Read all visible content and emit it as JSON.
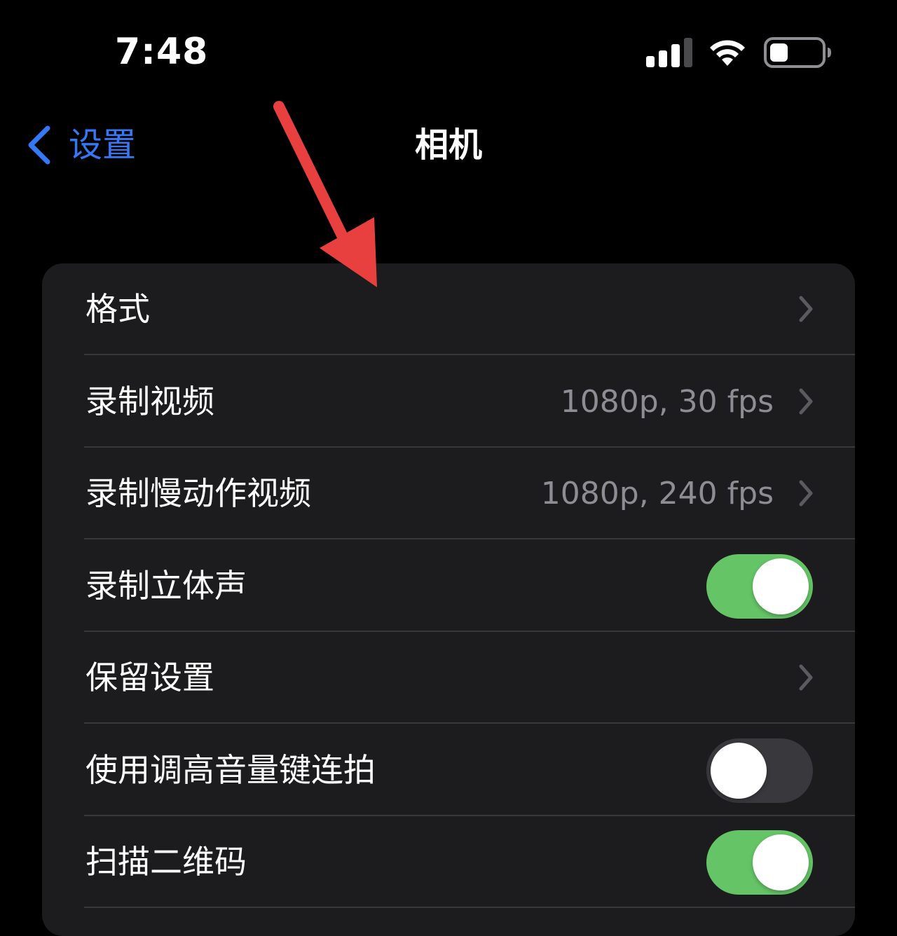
{
  "status_bar": {
    "time": "7:48",
    "icons": [
      "cellular-signal-icon",
      "wifi-icon",
      "battery-icon"
    ],
    "battery_level": 0.35
  },
  "nav": {
    "back_label": "设置",
    "title": "相机",
    "back_color": "#3478f6"
  },
  "annotation": {
    "type": "arrow",
    "color": "#e8403f"
  },
  "rows": [
    {
      "label": "格式",
      "value": "",
      "control": "chevron"
    },
    {
      "label": "录制视频",
      "value": "1080p, 30 fps",
      "control": "chevron"
    },
    {
      "label": "录制慢动作视频",
      "value": "1080p, 240 fps",
      "control": "chevron"
    },
    {
      "label": "录制立体声",
      "value": "",
      "control": "toggle",
      "on": true
    },
    {
      "label": "保留设置",
      "value": "",
      "control": "chevron"
    },
    {
      "label": "使用调高音量键连拍",
      "value": "",
      "control": "toggle",
      "on": false
    },
    {
      "label": "扫描二维码",
      "value": "",
      "control": "toggle",
      "on": true
    }
  ],
  "colors": {
    "background": "#000000",
    "group_background": "#1c1c1e",
    "toggle_on": "#65c466",
    "toggle_off": "#39393d",
    "secondary_text": "#8d8d93",
    "divider": "#38383a"
  }
}
